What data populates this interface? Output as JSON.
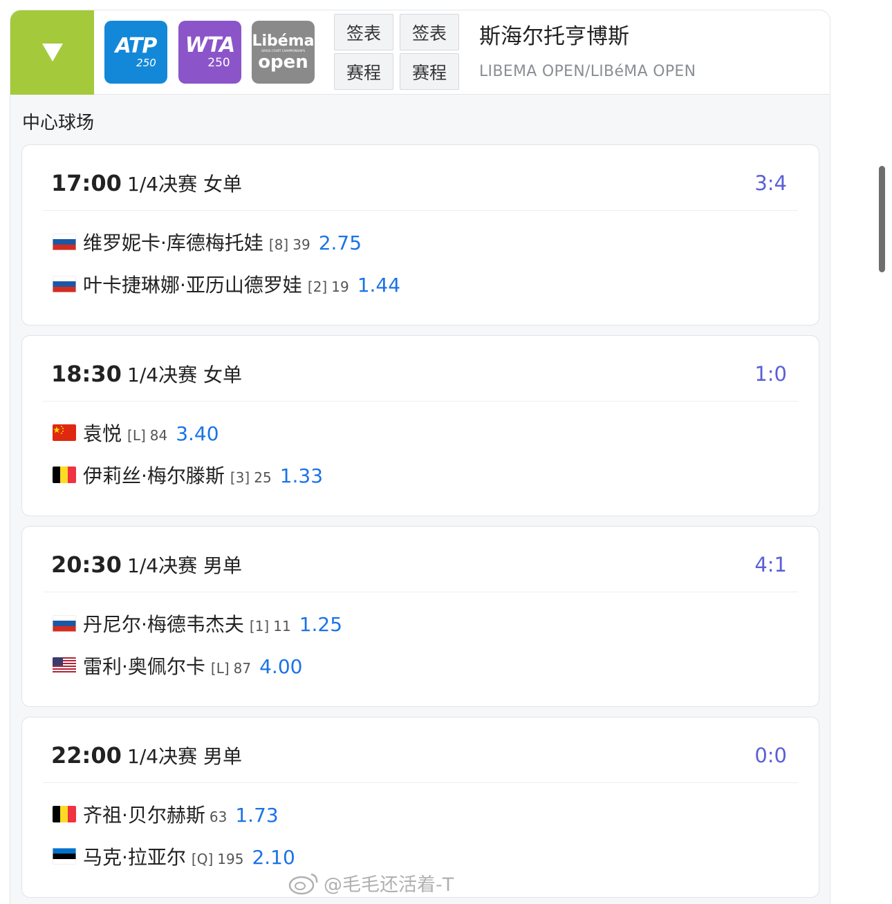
{
  "header": {
    "logos": [
      {
        "name": "atp",
        "text": "ATP",
        "sub": "250",
        "color": "#1388d8"
      },
      {
        "name": "wta",
        "text": "WTA",
        "sub": "250",
        "color": "#8b55c9"
      },
      {
        "name": "libema",
        "text": "Libéma",
        "tagline": "GRASS COURT CHAMPIONSHIPS",
        "sub": "open",
        "color": "#8a8a8a"
      }
    ],
    "buttons": [
      "签表",
      "签表",
      "赛程",
      "赛程"
    ],
    "tournament_name": "斯海尔托亨博斯",
    "tournament_name_en": "LIBEMA OPEN/LIBéMA OPEN",
    "toggle_color": "#a4c93b"
  },
  "court": "中心球场",
  "matches": [
    {
      "time": "17:00",
      "round": "1/4决赛 女单",
      "score": "3:4",
      "players": [
        {
          "flag": "russia",
          "name": "维罗妮卡·库德梅托娃",
          "seed": "[8]",
          "rank": "39",
          "odds": "2.75"
        },
        {
          "flag": "russia",
          "name": "叶卡捷琳娜·亚历山德罗娃",
          "seed": "[2]",
          "rank": "19",
          "odds": "1.44"
        }
      ]
    },
    {
      "time": "18:30",
      "round": "1/4决赛 女单",
      "score": "1:0",
      "players": [
        {
          "flag": "china",
          "name": "袁悦",
          "seed": "[L]",
          "rank": "84",
          "odds": "3.40"
        },
        {
          "flag": "belgium",
          "name": "伊莉丝·梅尔滕斯",
          "seed": "[3]",
          "rank": "25",
          "odds": "1.33"
        }
      ]
    },
    {
      "time": "20:30",
      "round": "1/4决赛 男单",
      "score": "4:1",
      "players": [
        {
          "flag": "russia",
          "name": "丹尼尔·梅德韦杰夫",
          "seed": "[1]",
          "rank": "11",
          "odds": "1.25"
        },
        {
          "flag": "usa",
          "name": "雷利·奥佩尔卡",
          "seed": "[L]",
          "rank": "87",
          "odds": "4.00"
        }
      ]
    },
    {
      "time": "22:00",
      "round": "1/4决赛 男单",
      "score": "0:0",
      "players": [
        {
          "flag": "belgium",
          "name": "齐祖·贝尔赫斯",
          "seed": "",
          "rank": "63",
          "odds": "1.73"
        },
        {
          "flag": "estonia",
          "name": "马克·拉亚尔",
          "seed": "[Q]",
          "rank": "195",
          "odds": "2.10"
        }
      ]
    }
  ],
  "colors": {
    "score": "#5b5fd6",
    "odds": "#1a73e8"
  },
  "watermark": "@毛毛还活着-T"
}
